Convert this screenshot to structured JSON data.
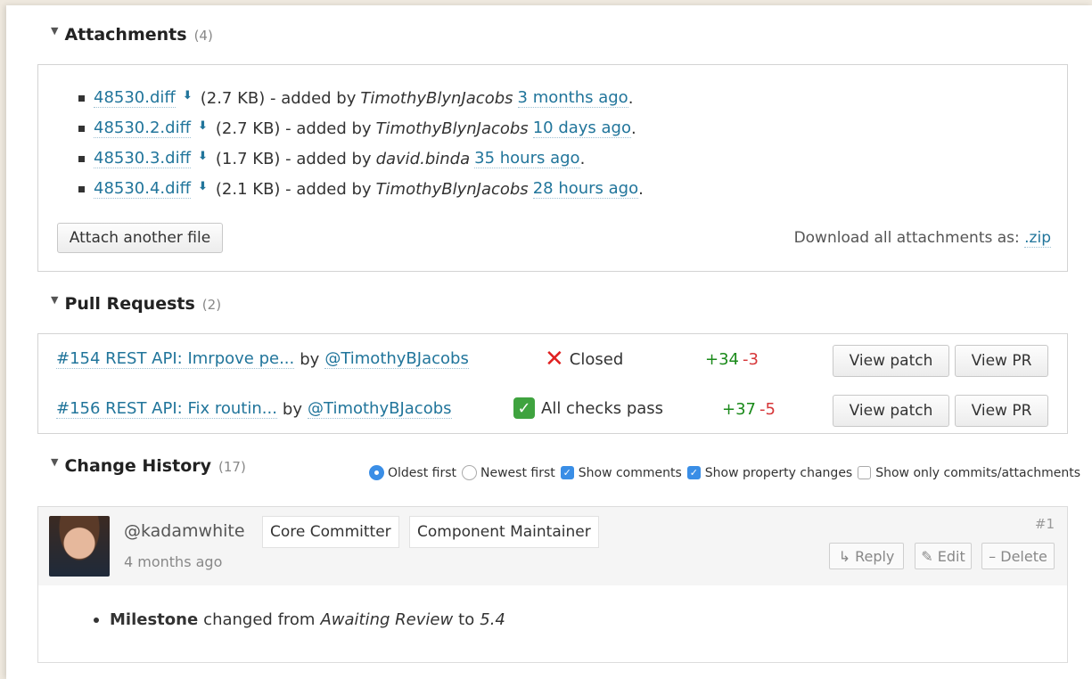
{
  "attachments": {
    "title": "Attachments",
    "count": "(4)",
    "items": [
      {
        "file": "48530.diff",
        "size": "(2.7 KB) - added by",
        "author": "TimothyBlynJacobs",
        "time": "3 months ago",
        "end": "."
      },
      {
        "file": "48530.2.diff",
        "size": "(2.7 KB) - added by",
        "author": "TimothyBlynJacobs",
        "time": "10 days ago",
        "end": "."
      },
      {
        "file": "48530.3.diff",
        "size": "(1.7 KB) - added by",
        "author": "david.binda",
        "time": "35 hours ago",
        "end": "."
      },
      {
        "file": "48530.4.diff",
        "size": "(2.1 KB) - added by",
        "author": "TimothyBlynJacobs",
        "time": "28 hours ago",
        "end": "."
      }
    ],
    "attach_button": "Attach another file",
    "download_text": "Download all attachments as:",
    "download_link": ".zip"
  },
  "pull_requests": {
    "title": "Pull Requests",
    "count": "(2)",
    "items": [
      {
        "title": "#154 REST API: Imrpove pe...",
        "by": "by",
        "user": "@TimothyBJacobs",
        "status_icon": "x-mark",
        "status": "Closed",
        "plus": "+34",
        "minus": "-3",
        "patch_button": "View patch",
        "pr_button": "View PR"
      },
      {
        "title": "#156 REST API: Fix routin...",
        "by": "by",
        "user": "@TimothyBJacobs",
        "status_icon": "check-mark",
        "status": "All checks pass",
        "plus": "+37",
        "minus": "-5",
        "patch_button": "View patch",
        "pr_button": "View PR"
      }
    ]
  },
  "history": {
    "title": "Change History",
    "count": "(17)",
    "options": {
      "oldest": "Oldest first",
      "newest": "Newest first",
      "show_comments": "Show comments",
      "show_property": "Show property changes",
      "show_only": "Show only commits/attachments"
    }
  },
  "comment": {
    "user": "@kadamwhite",
    "time": "4 months ago",
    "tags": [
      "Core Committer",
      "Component Maintainer"
    ],
    "number": "#1",
    "reply": "↳ Reply",
    "edit": "✎ Edit",
    "delete": "– Delete",
    "change_field": "Milestone",
    "change_from_text": "changed from",
    "change_from": "Awaiting Review",
    "change_to_text": "to",
    "change_to": "5.4"
  },
  "colors": {
    "link": "#21759b",
    "plus": "#1a8a1a",
    "minus": "#d63638",
    "checkbox": "#3a8ee6"
  }
}
